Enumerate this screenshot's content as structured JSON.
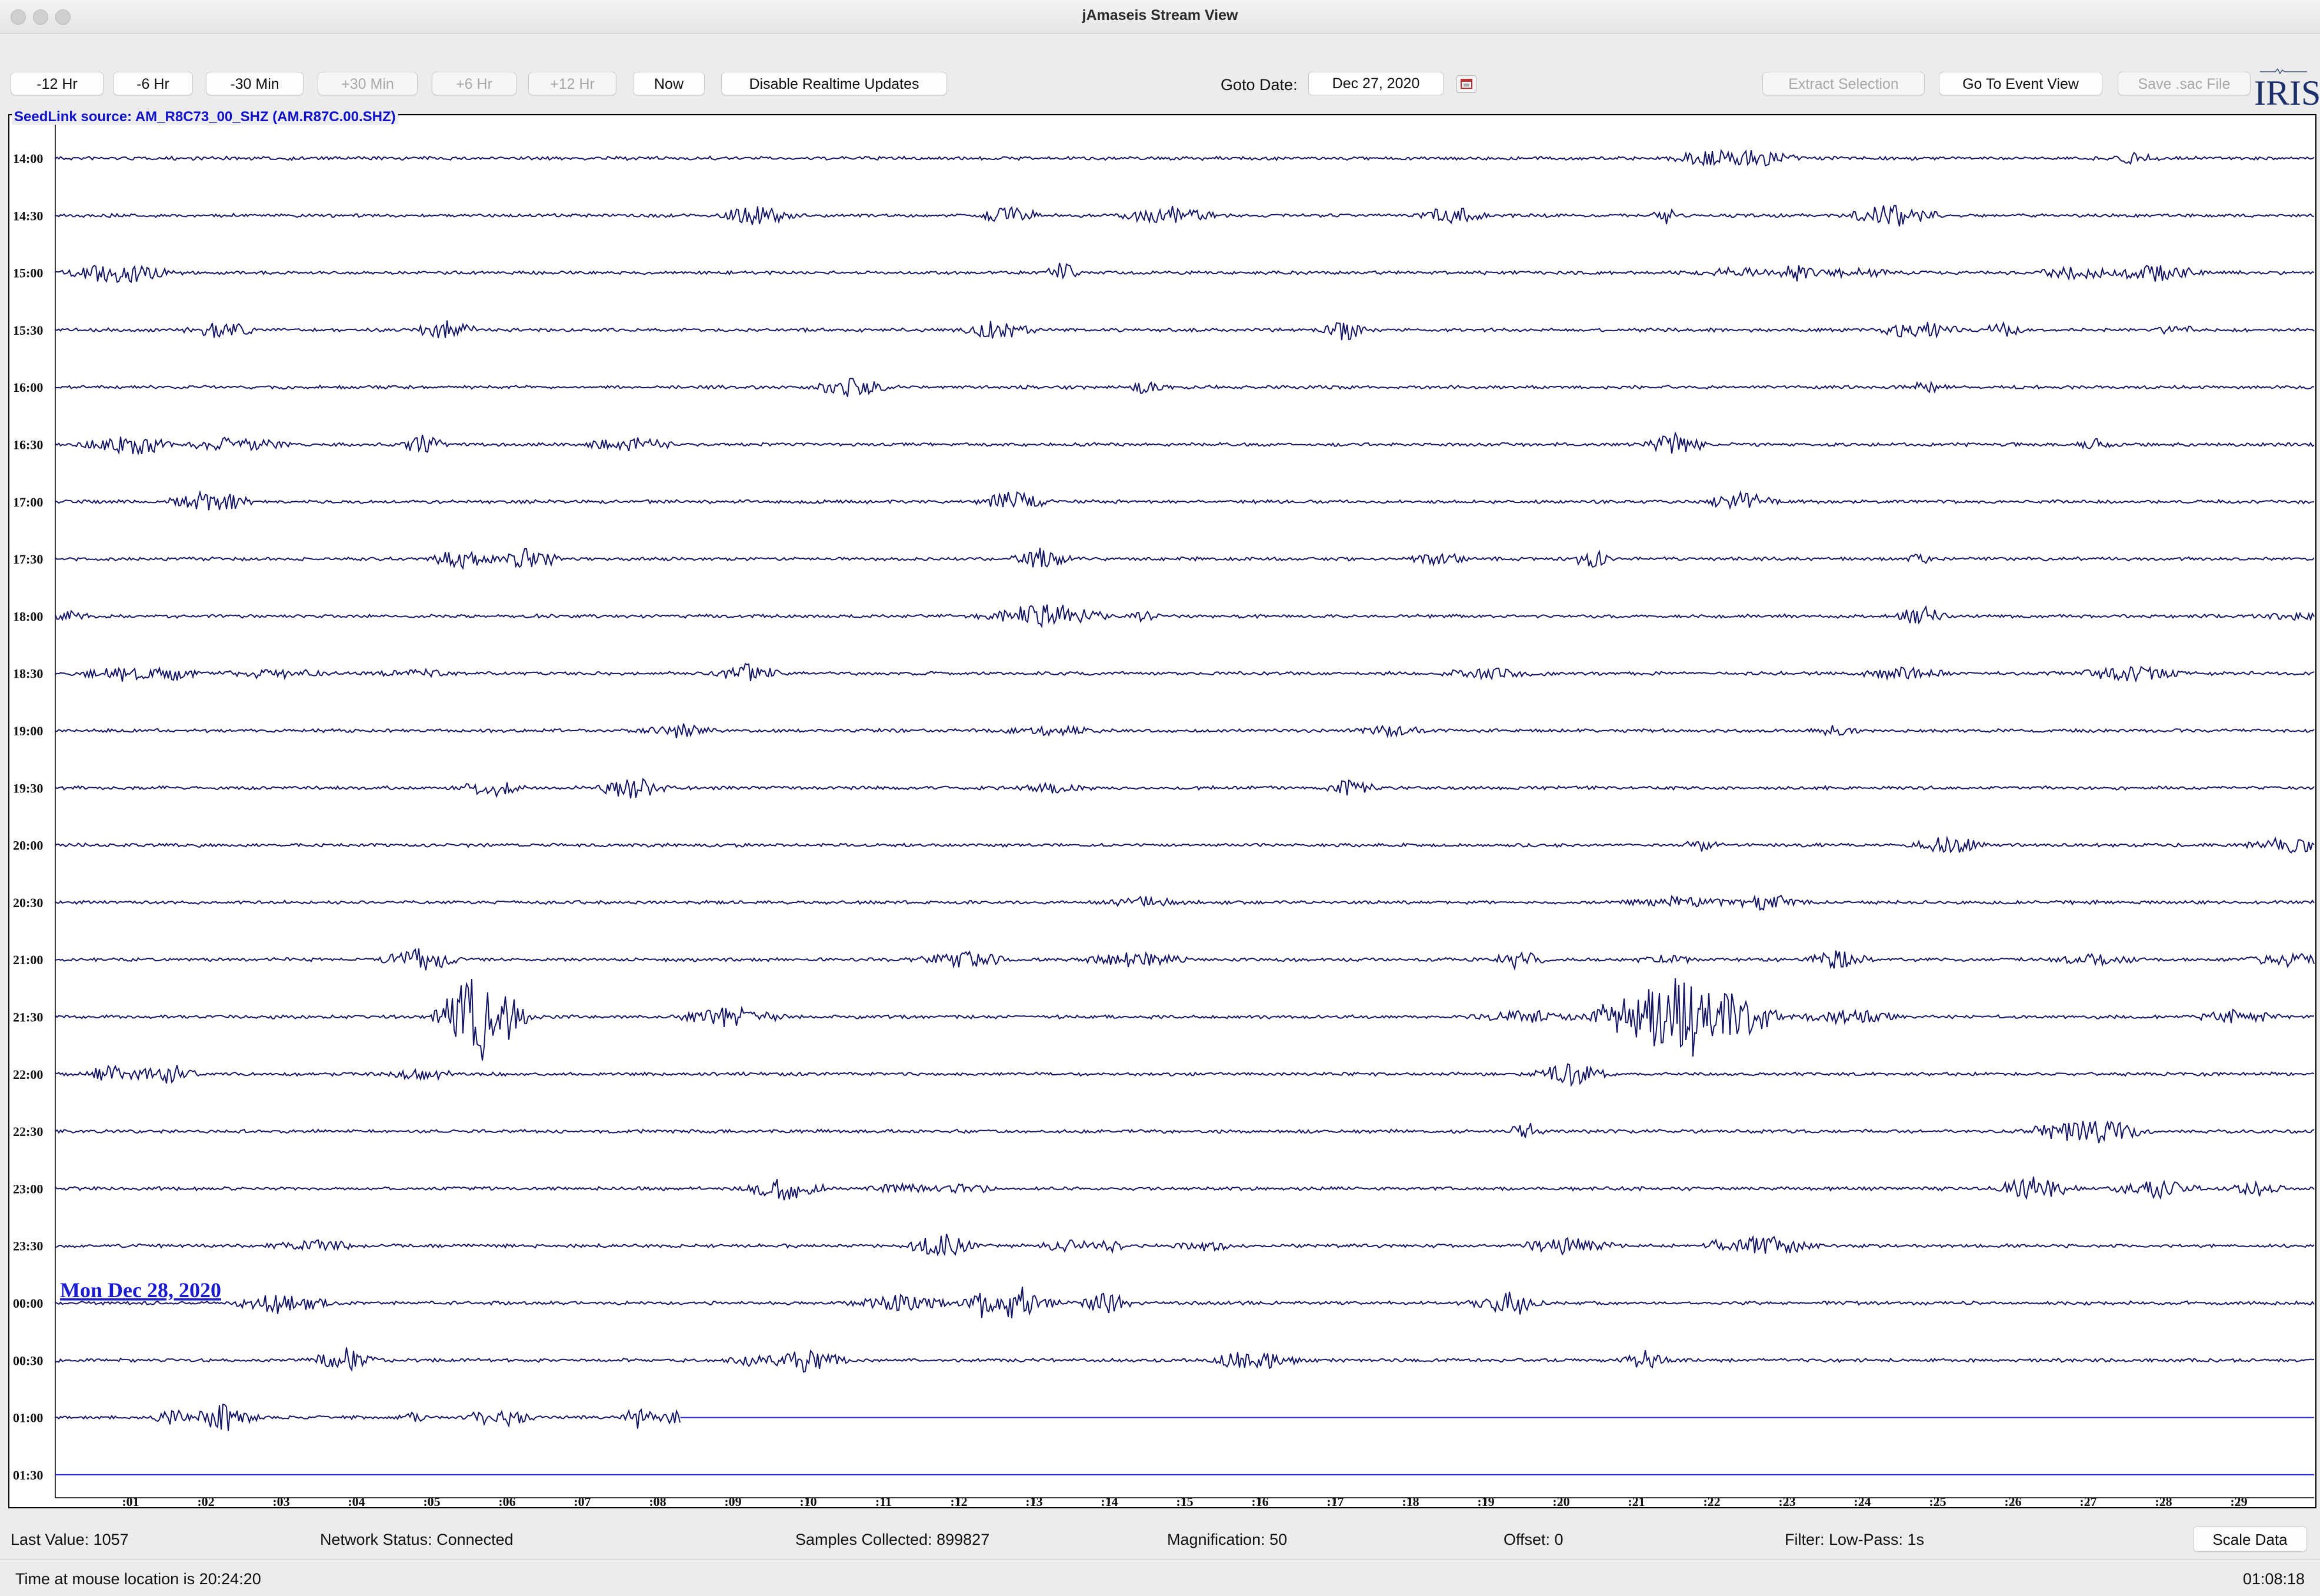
{
  "window": {
    "title": "jAmaseis Stream View"
  },
  "toolbar": {
    "buttons": [
      {
        "label": "-12 Hr",
        "enabled": true
      },
      {
        "label": "-6 Hr",
        "enabled": true
      },
      {
        "label": "-30 Min",
        "enabled": true
      },
      {
        "label": "+30 Min",
        "enabled": false
      },
      {
        "label": "+6 Hr",
        "enabled": false
      },
      {
        "label": "+12 Hr",
        "enabled": false
      },
      {
        "label": "Now",
        "enabled": true
      },
      {
        "label": "Disable Realtime Updates",
        "enabled": true
      }
    ],
    "goto_label": "Goto Date:",
    "goto_value": "Dec 27, 2020",
    "right_buttons": [
      {
        "label": "Extract Selection",
        "enabled": false
      },
      {
        "label": "Go To Event View",
        "enabled": true
      },
      {
        "label": "Save .sac File",
        "enabled": false
      }
    ],
    "logo_text": "IRIS",
    "calendar_icon": "calendar-icon"
  },
  "plot": {
    "source_label": "SeedLink  source: AM_R8C73_00_SHZ (AM.R87C.00.SHZ)",
    "date_label": "Mon Dec 28, 2020",
    "trace_color": "#141464",
    "empty_line_color": "#2a2af0",
    "rows": [
      "14:00",
      "14:30",
      "15:00",
      "15:30",
      "16:00",
      "16:30",
      "17:00",
      "17:30",
      "18:00",
      "18:30",
      "19:00",
      "19:30",
      "20:00",
      "20:30",
      "21:00",
      "21:30",
      "22:00",
      "22:30",
      "23:00",
      "23:30",
      "00:00",
      "00:30",
      "01:00",
      "01:30"
    ],
    "date_label_row": 20,
    "x_ticks": [
      ":01",
      ":02",
      ":03",
      ":04",
      ":05",
      ":06",
      ":07",
      ":08",
      ":09",
      ":10",
      ":11",
      ":12",
      ":13",
      ":14",
      ":15",
      ":16",
      ":17",
      ":18",
      ":19",
      ":20",
      ":21",
      ":22",
      ":23",
      ":24",
      ":25",
      ":26",
      ":27",
      ":28",
      ":29"
    ],
    "partial_row": 22,
    "partial_row_end_minute": 8.3
  },
  "status": {
    "last_value": "Last Value:  1057",
    "network": "Network Status:  Connected",
    "samples": "Samples Collected:  899827",
    "magnification": "Magnification:  50",
    "offset": "Offset:  0",
    "filter": "Filter:  Low-Pass: 1s",
    "scale_button": "Scale Data"
  },
  "footer": {
    "mouse_time": "Time at mouse location is 20:24:20",
    "clock": "01:08:18"
  }
}
